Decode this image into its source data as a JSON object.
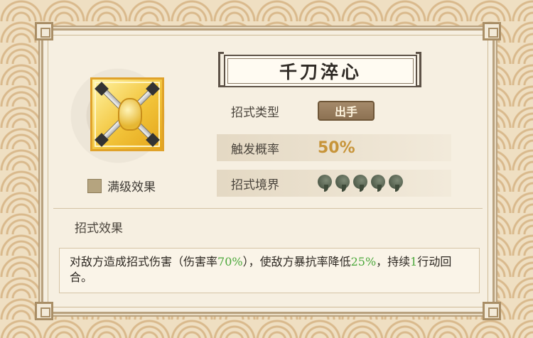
{
  "skill": {
    "name": "千刀淬心",
    "max_level_label": "满级效果",
    "icon": "golden-fist-with-crossed-swords-icon"
  },
  "attributes": {
    "type_label": "招式类型",
    "type_value": "出手",
    "trigger_label": "触发概率",
    "trigger_value": "50%",
    "realm_label": "招式境界",
    "realm_beads": 5
  },
  "effect": {
    "title": "招式效果",
    "segments": [
      {
        "text": "对敌方造成招式伤害（伤害率",
        "color": "default"
      },
      {
        "text": "70%",
        "color": "green"
      },
      {
        "text": "），使敌方暴抗率降低",
        "color": "default"
      },
      {
        "text": "25%",
        "color": "green"
      },
      {
        "text": "，持续",
        "color": "default"
      },
      {
        "text": "1",
        "color": "green"
      },
      {
        "text": "行动回合。",
        "color": "default"
      }
    ]
  },
  "colors": {
    "highlight_green": "#4ba83b",
    "rate_gold": "#c79439",
    "badge_brown": "#8d7253"
  }
}
